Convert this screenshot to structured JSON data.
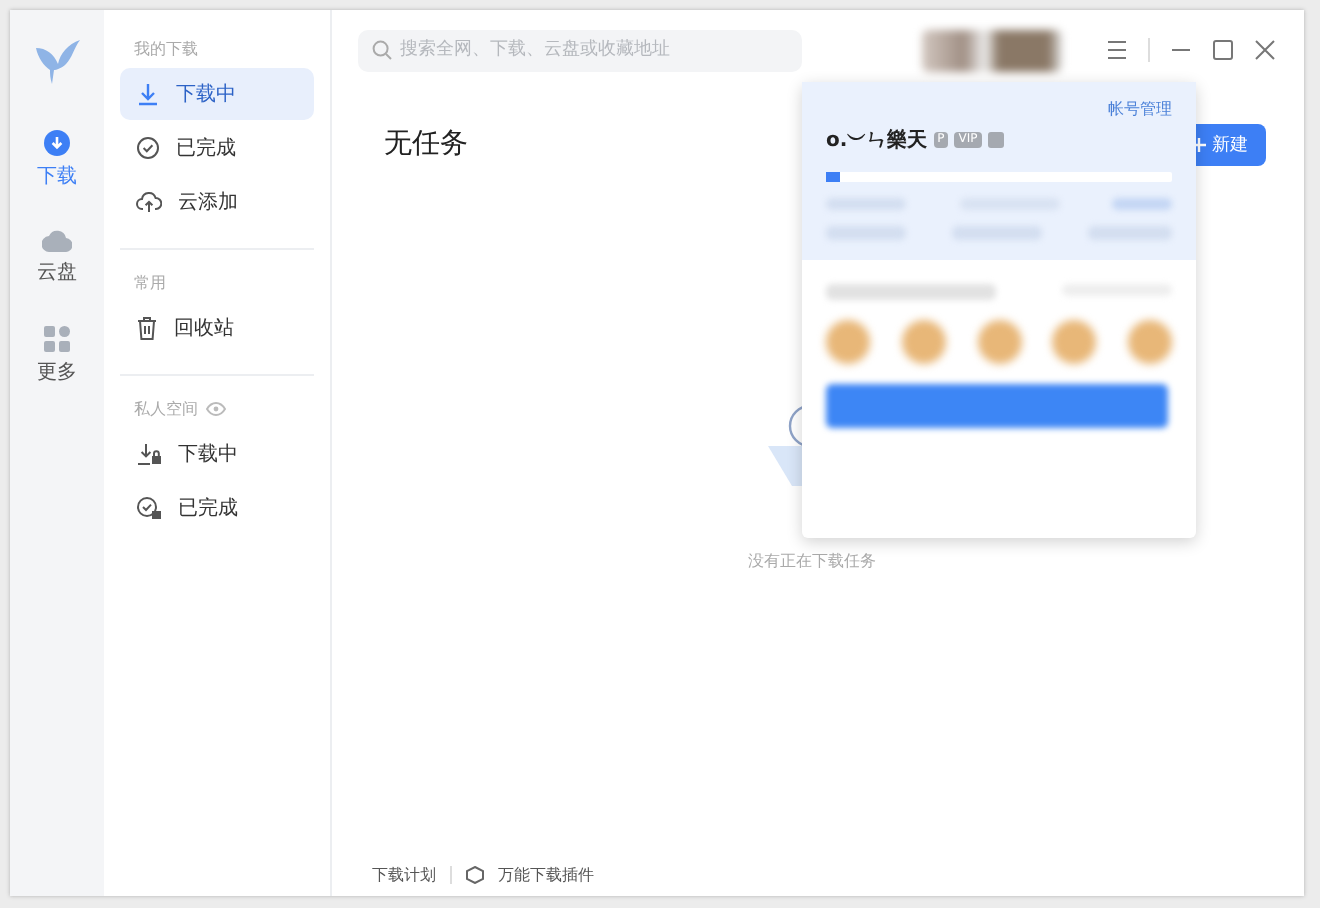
{
  "rail": [
    {
      "label": "下载",
      "selected": true
    },
    {
      "label": "云盘",
      "selected": false
    },
    {
      "label": "更多",
      "selected": false
    }
  ],
  "nav": [
    {
      "title": "我的下载",
      "items": [
        {
          "label": "下载中",
          "selected": true
        },
        {
          "label": "已完成",
          "selected": false
        },
        {
          "label": "云添加",
          "selected": false
        }
      ]
    },
    {
      "title": "常用",
      "items": [
        {
          "label": "回收站",
          "selected": false
        }
      ]
    },
    {
      "title": "私人空间",
      "items": [
        {
          "label": "下载中",
          "selected": false
        },
        {
          "label": "已完成",
          "selected": false
        }
      ]
    }
  ],
  "search": {
    "placeholder": "搜索全网、下载、云盘或收藏地址"
  },
  "main": {
    "title": "无任务",
    "new_button": "新建",
    "empty_message": "没有正在下载任务"
  },
  "footer": [
    "下载计划",
    "万能下载插件"
  ],
  "account_popup": {
    "manage_link": "帐号管理",
    "username": "o.︶ㄣ樂天",
    "badges": [
      "P",
      "VIP"
    ],
    "level": 0.04
  }
}
